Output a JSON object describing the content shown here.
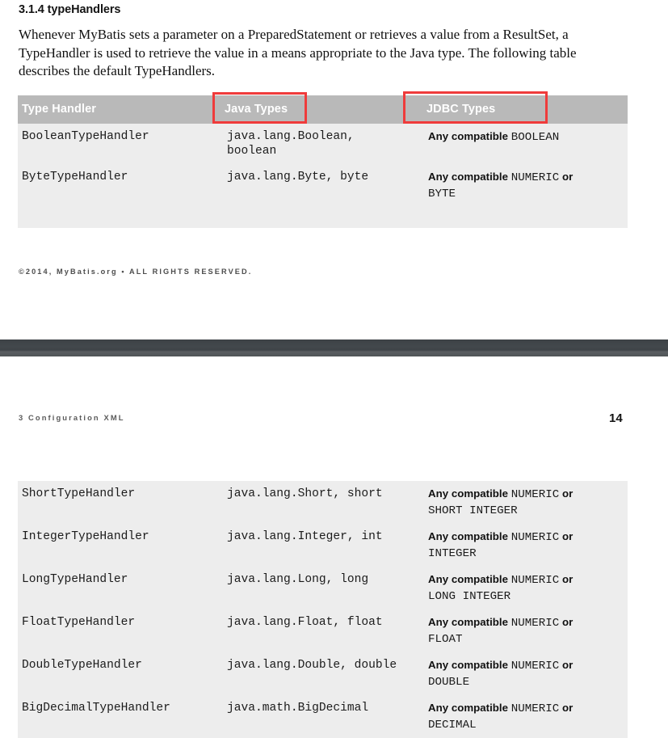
{
  "document": {
    "section": {
      "heading": "3.1.4 typeHandlers",
      "paragraph": "Whenever MyBatis sets a parameter on a PreparedStatement or retrieves a value from a ResultSet, a TypeHandler is used to retrieve the value in a means appropriate to the Java type. The following table describes the default TypeHandlers."
    },
    "page_one": {
      "table": {
        "headers": [
          "Type Handler",
          "Java Types",
          "JDBC Types"
        ],
        "rows": [
          {
            "type_handler": "BooleanTypeHandler",
            "java_types": "java.lang.Boolean,\nboolean",
            "jdbc_prefix": "Any compatible ",
            "jdbc_code": "BOOLEAN",
            "jdbc_suffix": "",
            "jdbc_code2": ""
          },
          {
            "type_handler": "ByteTypeHandler",
            "java_types": "java.lang.Byte, byte",
            "jdbc_prefix": "Any compatible ",
            "jdbc_code": "NUMERIC",
            "jdbc_suffix": " or",
            "jdbc_code2": "BYTE"
          }
        ]
      },
      "footer": "©2014, MyBatis.org • ALL RIGHTS RESERVED."
    },
    "page_two": {
      "running_head": "3 Configuration XML",
      "page_number": "14",
      "table": {
        "rows": [
          {
            "type_handler": "ShortTypeHandler",
            "java_types": "java.lang.Short, short",
            "jdbc_prefix": "Any compatible ",
            "jdbc_code": "NUMERIC",
            "jdbc_suffix": " or",
            "jdbc_code2": "SHORT INTEGER"
          },
          {
            "type_handler": "IntegerTypeHandler",
            "java_types": "java.lang.Integer, int",
            "jdbc_prefix": "Any compatible ",
            "jdbc_code": "NUMERIC",
            "jdbc_suffix": " or",
            "jdbc_code2": "INTEGER"
          },
          {
            "type_handler": "LongTypeHandler",
            "java_types": "java.lang.Long, long",
            "jdbc_prefix": "Any compatible ",
            "jdbc_code": "NUMERIC",
            "jdbc_suffix": " or",
            "jdbc_code2": "LONG INTEGER"
          },
          {
            "type_handler": "FloatTypeHandler",
            "java_types": "java.lang.Float, float",
            "jdbc_prefix": "Any compatible ",
            "jdbc_code": "NUMERIC",
            "jdbc_suffix": " or",
            "jdbc_code2": "FLOAT"
          },
          {
            "type_handler": "DoubleTypeHandler",
            "java_types": "java.lang.Double, double",
            "jdbc_prefix": "Any compatible ",
            "jdbc_code": "NUMERIC",
            "jdbc_suffix": " or",
            "jdbc_code2": "DOUBLE"
          },
          {
            "type_handler": "BigDecimalTypeHandler",
            "java_types": "java.math.BigDecimal",
            "jdbc_prefix": "Any compatible ",
            "jdbc_code": "NUMERIC",
            "jdbc_suffix": " or",
            "jdbc_code2": "DECIMAL"
          }
        ]
      }
    },
    "annotations": [
      {
        "label": "java-types-highlight",
        "color": "#ef3b3b"
      },
      {
        "label": "jdbc-types-highlight",
        "color": "#ef3b3b"
      }
    ],
    "colors": {
      "header_bg": "#b9b9b9",
      "body_bg": "#ededed",
      "annotation": "#ef3b3b",
      "divider": "#43484c"
    }
  }
}
